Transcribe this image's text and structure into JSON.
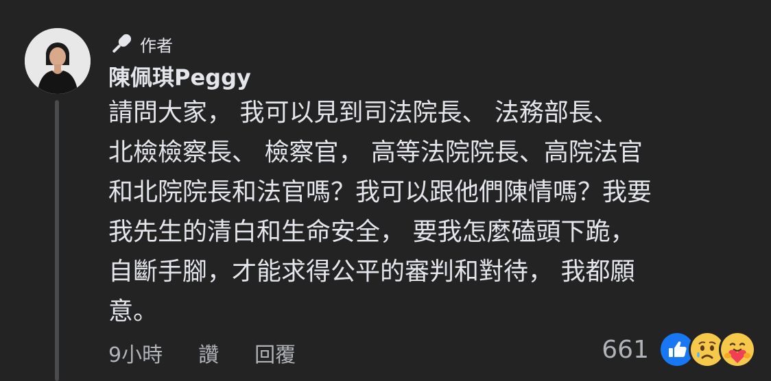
{
  "comment": {
    "author_badge": "作者",
    "author_name": "陳佩琪Peggy",
    "lines": [
      "請問大家， 我可以見到司法院長、 法務部長、",
      "北檢檢察長、 檢察官， 高等法院院長、高院法官",
      "和北院院長和法官嗎？我可以跟他們陳情嗎？我要",
      "我先生的清白和生命安全， 要我怎麼磕頭下跪，",
      "自斷手腳，才能求得公平的審判和對待， 我都願",
      "意。"
    ]
  },
  "actions": {
    "time": "9小時",
    "like_label": "讚",
    "reply_label": "回覆"
  },
  "reactions": {
    "count": "661",
    "icons": [
      "like-reaction-icon",
      "sad-reaction-icon",
      "care-reaction-icon"
    ]
  },
  "colors": {
    "background": "#232324",
    "primary_text": "#e4e6eb",
    "secondary_text": "#b0b3b8",
    "like_blue": "#1877f2",
    "emoji_yellow": "#f7c94b",
    "heart_red": "#f33e58"
  }
}
